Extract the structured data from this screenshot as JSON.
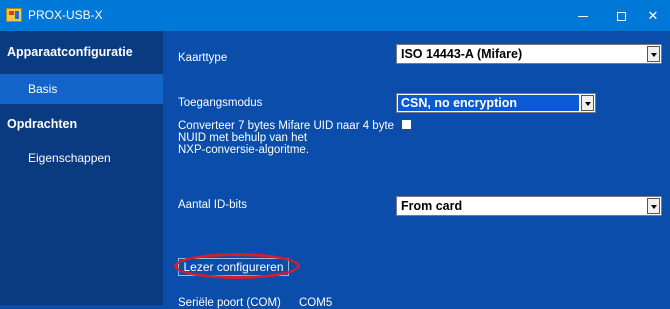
{
  "window": {
    "title": "PROX-USB-X",
    "minimize_label": "–",
    "maximize_label": "□",
    "close_label": "✕"
  },
  "sidebar": {
    "sections": [
      {
        "label": "Apparaatconfiguratie",
        "items": [
          {
            "label": "Basis",
            "selected": true
          }
        ]
      },
      {
        "label": "Opdrachten",
        "items": [
          {
            "label": "Eigenschappen",
            "selected": false
          }
        ]
      }
    ]
  },
  "form": {
    "card_type": {
      "label": "Kaarttype",
      "value": "ISO 14443-A (Mifare)"
    },
    "access_mode": {
      "label": "Toegangsmodus",
      "value": "CSN, no encryption"
    },
    "convert_uid": {
      "label_lines": [
        "Converteer 7 bytes Mifare UID naar 4 byte",
        "NUID met behulp van het",
        "NXP-conversie-algoritme."
      ],
      "checked": false
    },
    "id_bits": {
      "label": "Aantal ID-bits",
      "value": "From card"
    },
    "configure_button": "Lezer configureren"
  },
  "footer": {
    "serial_port_label": "Seriële poort (COM)",
    "serial_port_value": "COM5"
  },
  "colors": {
    "titlebar": "#0078d7",
    "background": "#0a4dab",
    "sidebar": "#0a3a7f",
    "selected_item": "#1364c8",
    "highlight_ring": "#d21f29"
  }
}
